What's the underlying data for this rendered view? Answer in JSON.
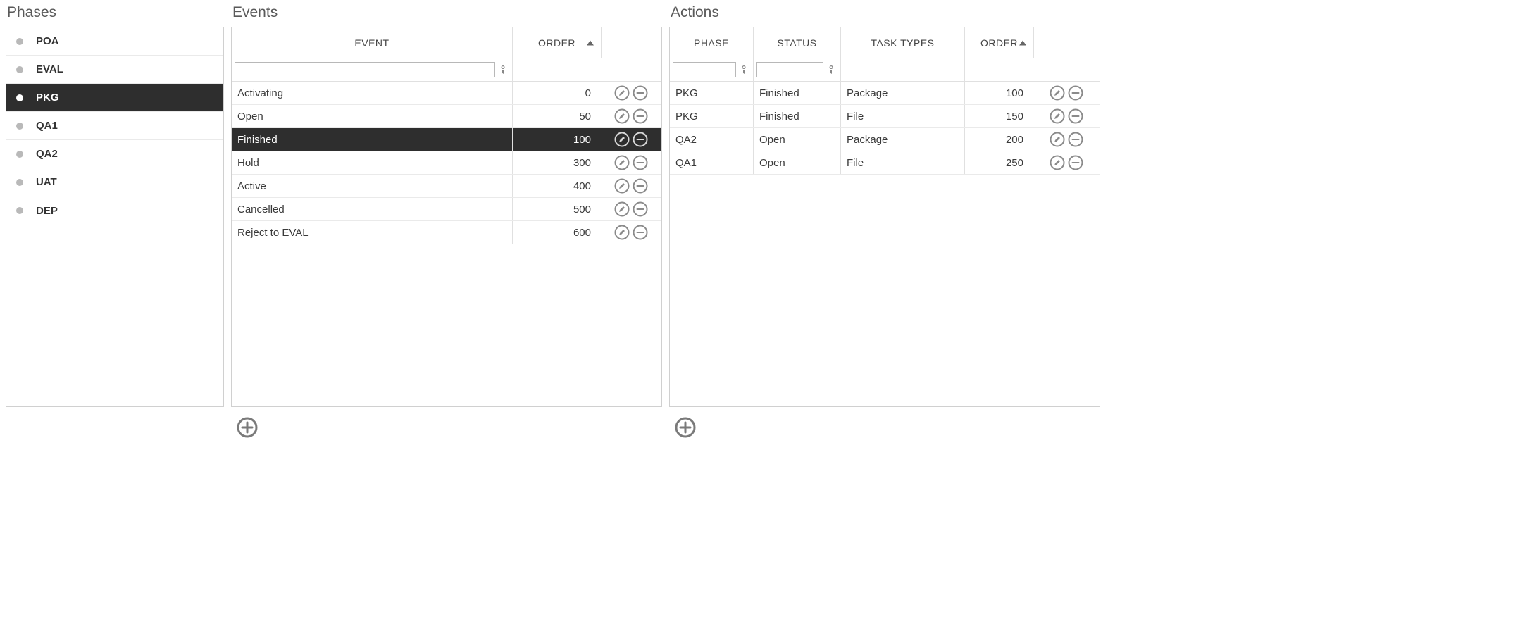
{
  "phases": {
    "title": "Phases",
    "items": [
      {
        "label": "POA",
        "selected": false
      },
      {
        "label": "EVAL",
        "selected": false
      },
      {
        "label": "PKG",
        "selected": true
      },
      {
        "label": "QA1",
        "selected": false
      },
      {
        "label": "QA2",
        "selected": false
      },
      {
        "label": "UAT",
        "selected": false
      },
      {
        "label": "DEP",
        "selected": false
      }
    ]
  },
  "events": {
    "title": "Events",
    "headers": {
      "event": "EVENT",
      "order": "ORDER"
    },
    "filter": {
      "event": ""
    },
    "rows": [
      {
        "event": "Activating",
        "order": "0",
        "selected": false
      },
      {
        "event": "Open",
        "order": "50",
        "selected": false
      },
      {
        "event": "Finished",
        "order": "100",
        "selected": true
      },
      {
        "event": "Hold",
        "order": "300",
        "selected": false
      },
      {
        "event": "Active",
        "order": "400",
        "selected": false
      },
      {
        "event": "Cancelled",
        "order": "500",
        "selected": false
      },
      {
        "event": "Reject to EVAL",
        "order": "600",
        "selected": false
      }
    ]
  },
  "actions": {
    "title": "Actions",
    "headers": {
      "phase": "PHASE",
      "status": "STATUS",
      "types": "TASK TYPES",
      "order": "ORDER"
    },
    "filter": {
      "phase": "",
      "status": ""
    },
    "rows": [
      {
        "phase": "PKG",
        "status": "Finished",
        "types": "Package",
        "order": "100"
      },
      {
        "phase": "PKG",
        "status": "Finished",
        "types": "File",
        "order": "150"
      },
      {
        "phase": "QA2",
        "status": "Open",
        "types": "Package",
        "order": "200"
      },
      {
        "phase": "QA1",
        "status": "Open",
        "types": "File",
        "order": "250"
      }
    ]
  }
}
